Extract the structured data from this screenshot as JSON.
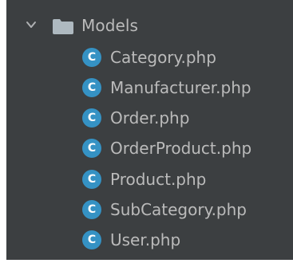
{
  "colors": {
    "panel_background": "#3c3f41",
    "text": "#bbbbbb",
    "class_icon": "#3592c4",
    "folder_icon": "#aeb9c0"
  },
  "folder": {
    "label": "Models",
    "expanded": true,
    "chevron_icon": "chevron-down-icon",
    "icon": "folder-icon"
  },
  "files": [
    {
      "label": "Category.php",
      "icon": "php-class-icon",
      "icon_letter": "C"
    },
    {
      "label": "Manufacturer.php",
      "icon": "php-class-icon",
      "icon_letter": "C"
    },
    {
      "label": "Order.php",
      "icon": "php-class-icon",
      "icon_letter": "C"
    },
    {
      "label": "OrderProduct.php",
      "icon": "php-class-icon",
      "icon_letter": "C"
    },
    {
      "label": "Product.php",
      "icon": "php-class-icon",
      "icon_letter": "C"
    },
    {
      "label": "SubCategory.php",
      "icon": "php-class-icon",
      "icon_letter": "C"
    },
    {
      "label": "User.php",
      "icon": "php-class-icon",
      "icon_letter": "C"
    }
  ]
}
